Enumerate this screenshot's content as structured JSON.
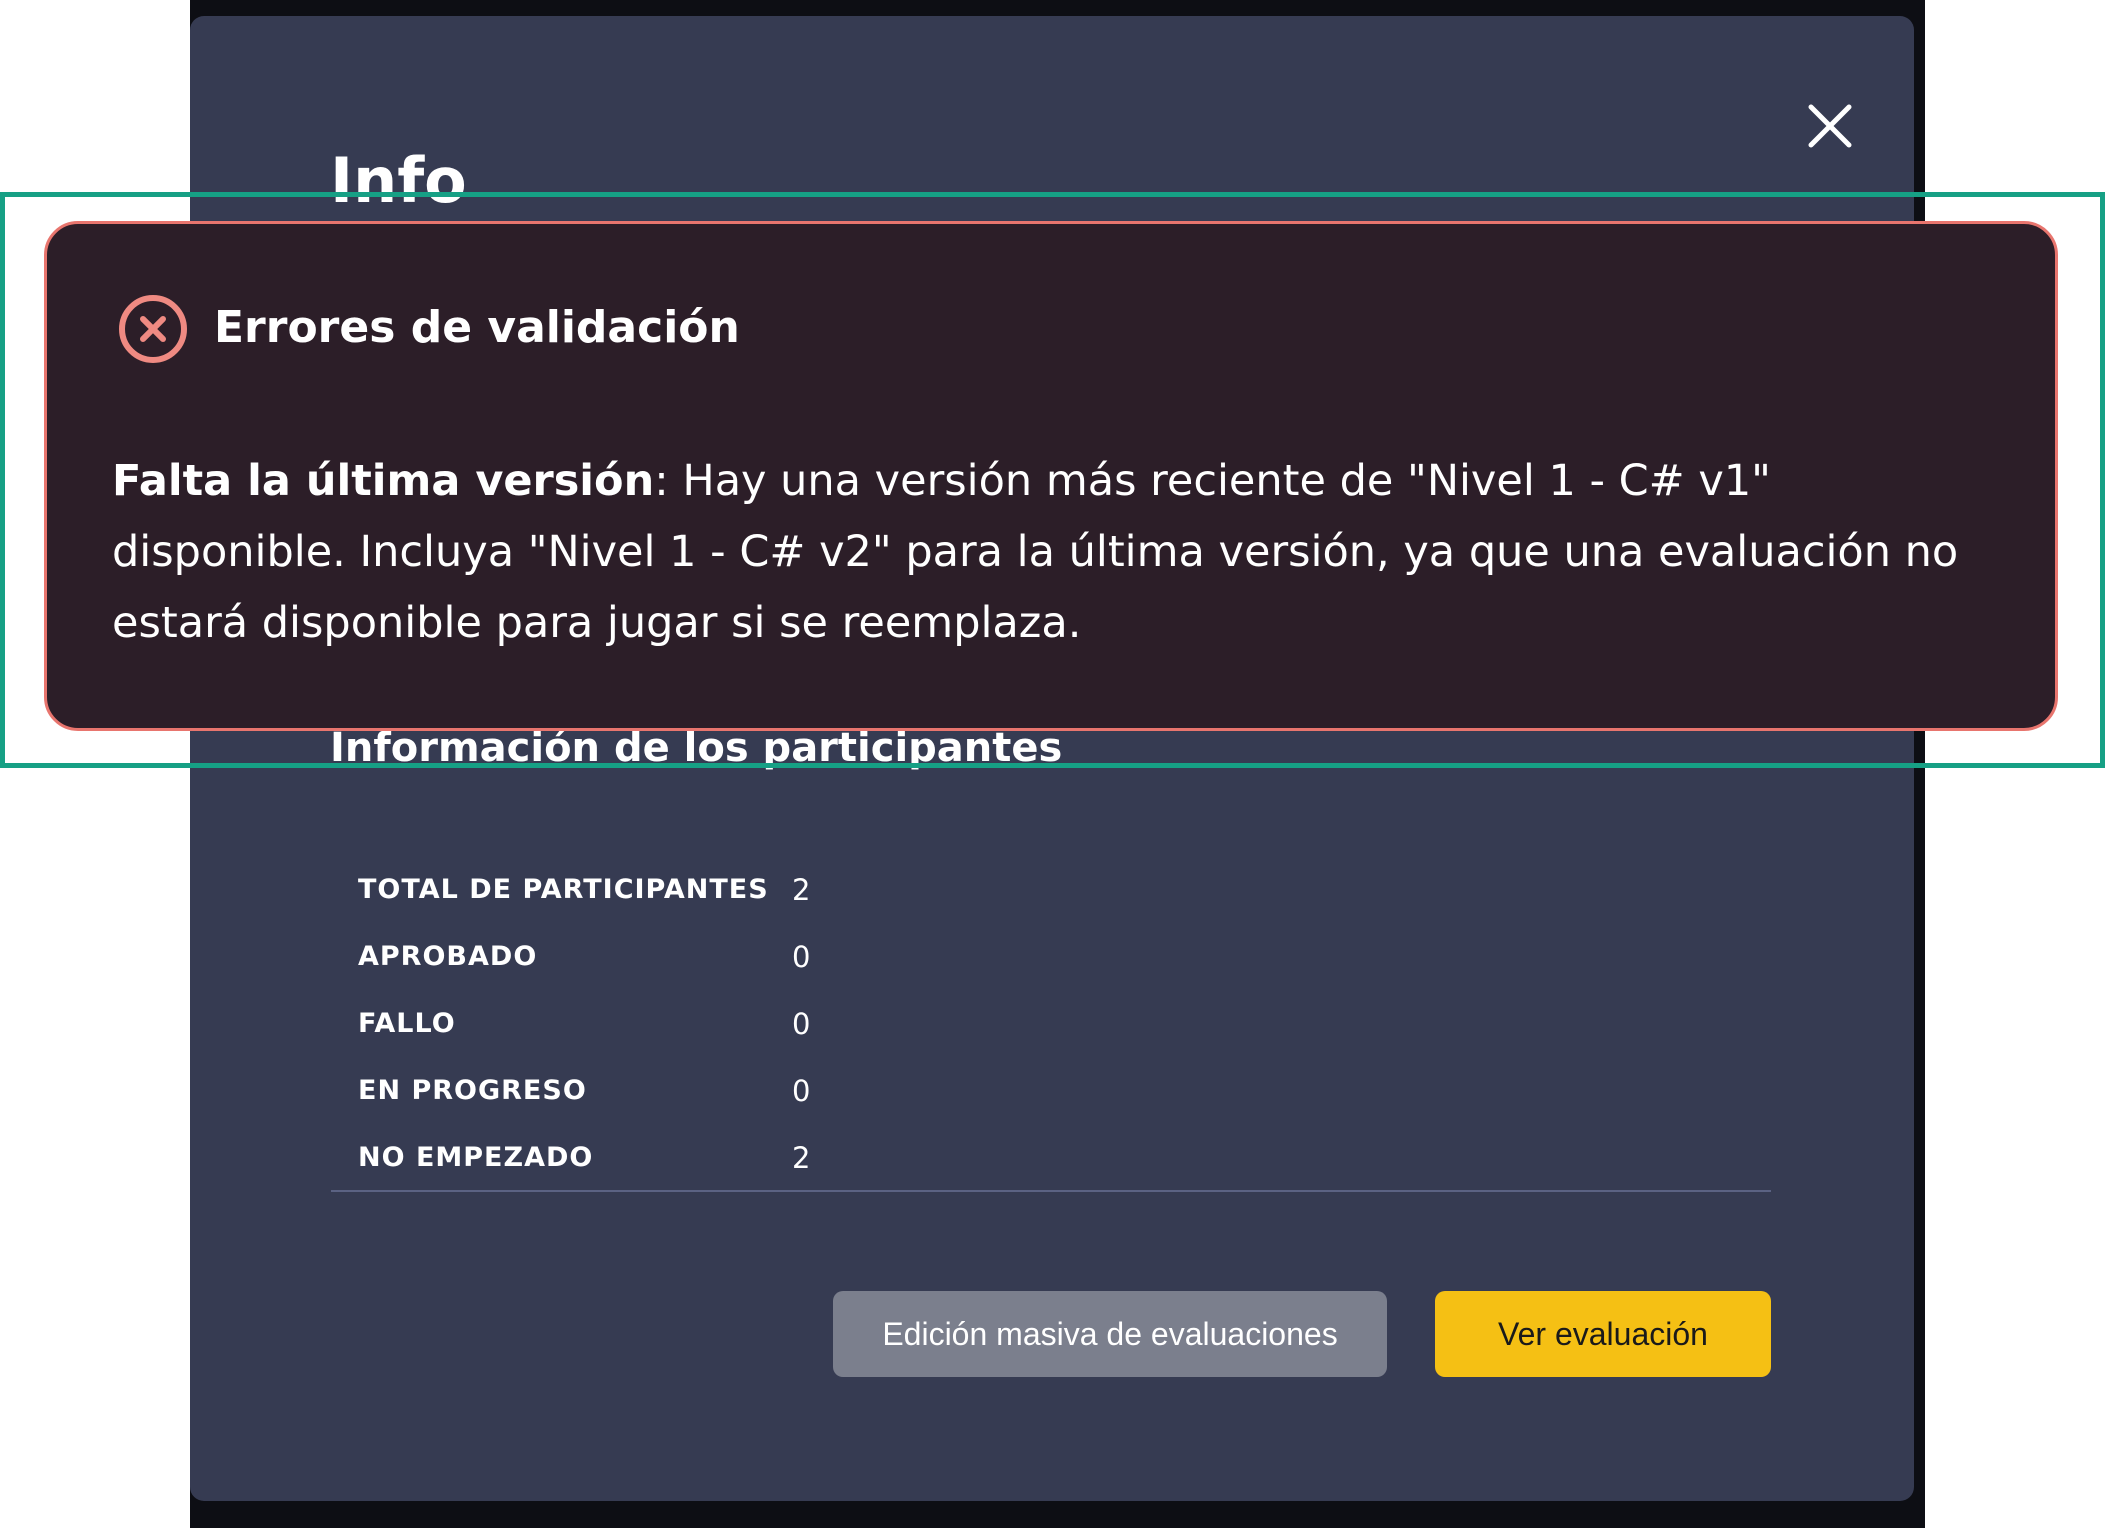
{
  "modal": {
    "title": "Info",
    "close_icon": "close-icon",
    "participants_heading": "Información de los participantes",
    "stats": [
      {
        "label": "TOTAL DE PARTICIPANTES",
        "value": "2"
      },
      {
        "label": "APROBADO",
        "value": "0"
      },
      {
        "label": "FALLO",
        "value": "0"
      },
      {
        "label": "EN PROGRESO",
        "value": "0"
      },
      {
        "label": "NO EMPEZADO",
        "value": "2"
      }
    ],
    "buttons": {
      "bulk_edit_label": "Edición masiva de evaluaciones",
      "view_label": "Ver evaluación"
    }
  },
  "validation_error": {
    "icon": "error-circle-x-icon",
    "title": "Errores de validación",
    "message_bold": "Falta la última versión",
    "message_rest": ": Hay una versión más reciente de \"Nivel 1 - C# v1\" disponible. Incluya \"Nivel 1 - C# v2\" para la última versión, ya que una evaluación no estará disponible para jugar si se reemplaza."
  },
  "colors": {
    "modal_bg": "#363b52",
    "error_bg": "#2c1e28",
    "error_border": "#e8756e",
    "highlight": "#16a085",
    "primary_button": "#f5c014",
    "secondary_button": "#7b7f8d"
  }
}
